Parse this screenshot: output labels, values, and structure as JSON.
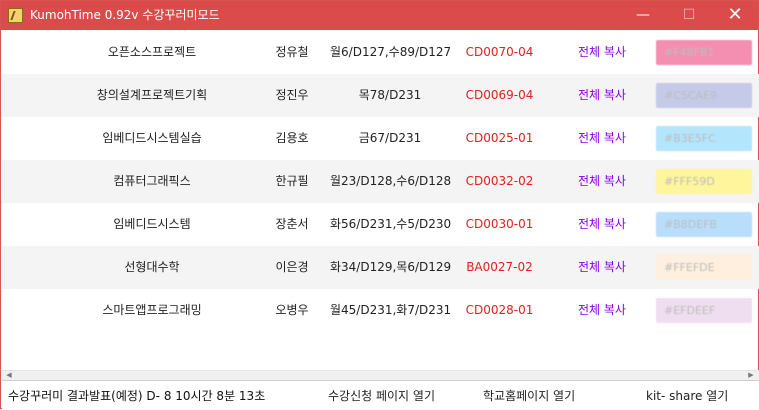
{
  "window": {
    "title": "KumohTime 0.92v 수강꾸러미모드",
    "minimize_glyph": "—",
    "maximize_glyph": "☐",
    "close_glyph": "✕",
    "accent_color": "#dc4b4b"
  },
  "courses": [
    {
      "name": "오픈소스프로젝트",
      "professor": "정유철",
      "time": "월6/D127,수89/D127",
      "code": "CD0070-04",
      "copy_label": "전체 복사",
      "color_label": "#F48FB1",
      "color": "#F48FB1"
    },
    {
      "name": "창의설계프로젝트기획",
      "professor": "정진우",
      "time": "목78/D231",
      "code": "CD0069-04",
      "copy_label": "전체 복사",
      "color_label": "#C5CAE9",
      "color": "#C5CAE9"
    },
    {
      "name": "임베디드시스템실습",
      "professor": "김용호",
      "time": "금67/D231",
      "code": "CD0025-01",
      "copy_label": "전체 복사",
      "color_label": "#B3E5FC",
      "color": "#B3E5FC"
    },
    {
      "name": "컴퓨터그래픽스",
      "professor": "한규필",
      "time": "월23/D128,수6/D128",
      "code": "CD0032-02",
      "copy_label": "전체 복사",
      "color_label": "#FFF59D",
      "color": "#FFF59D"
    },
    {
      "name": "임베디드시스템",
      "professor": "장춘서",
      "time": "화56/D231,수5/D230",
      "code": "CD0030-01",
      "copy_label": "전체 복사",
      "color_label": "#B8DEFB",
      "color": "#B8DEFB"
    },
    {
      "name": "선형대수학",
      "professor": "이은경",
      "time": "화34/D129,목6/D129",
      "code": "BA0027-02",
      "copy_label": "전체 복사",
      "color_label": "#FFEFDE",
      "color": "#FFEFDE"
    },
    {
      "name": "스마트앱프로그래밍",
      "professor": "오병우",
      "time": "월45/D231,화7/D231",
      "code": "CD0028-01",
      "copy_label": "전체 복사",
      "color_label": "#EFDEEF",
      "color": "#EFDEEF"
    }
  ],
  "scrollbar": {
    "left_arrow": "◀",
    "right_arrow": "▶"
  },
  "status": {
    "countdown": "수강꾸러미 결과발표(예정)  D- 8 10시간 8분 13초",
    "registration_link": "수강신청 페이지 열기",
    "school_link": "학교홈페이지 열기",
    "share_link": "kit- share 열기"
  }
}
